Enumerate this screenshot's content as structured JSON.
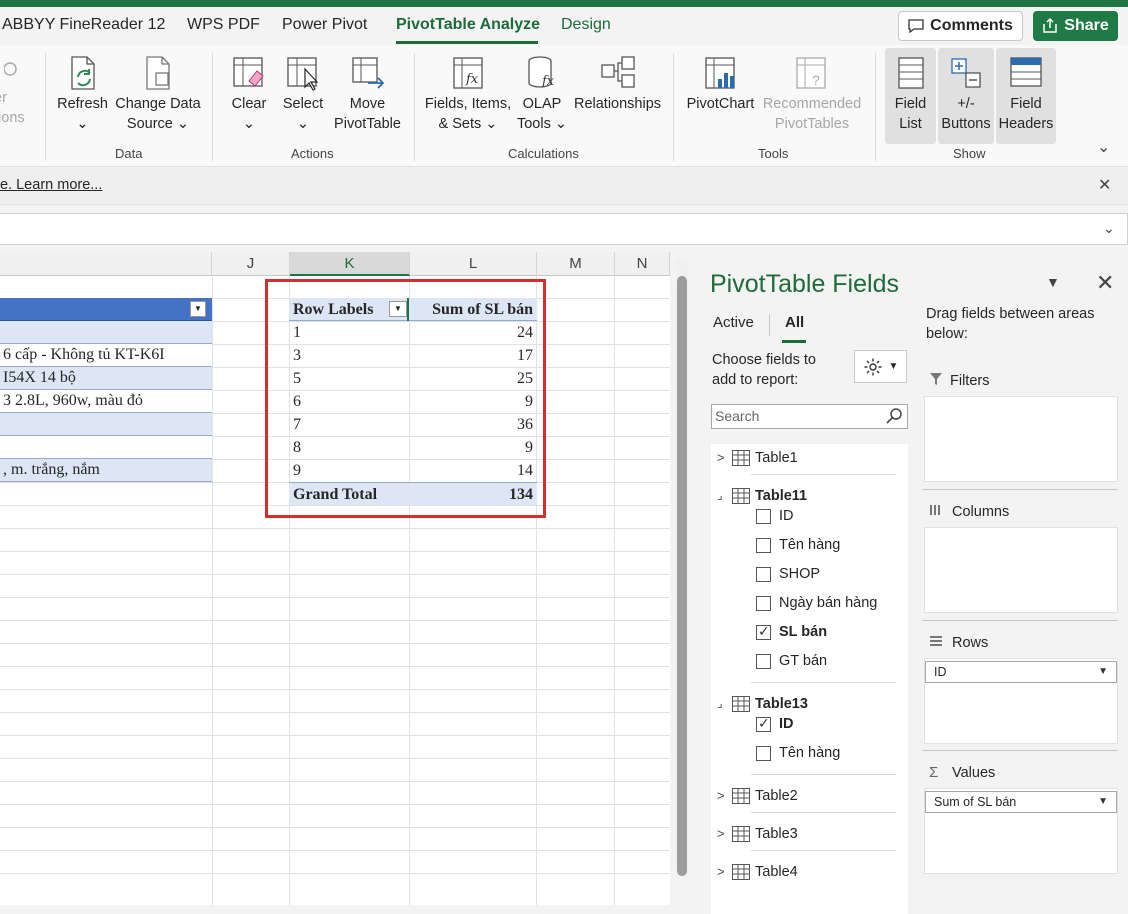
{
  "tabs": {
    "items": [
      "ABBYY FineReader 12",
      "WPS PDF",
      "Power Pivot",
      "PivotTable Analyze",
      "Design"
    ],
    "active": "PivotTable Analyze",
    "comments_label": "Comments",
    "share_label": "Share"
  },
  "ribbon": {
    "partial_left_top": "er",
    "partial_left_bottom": "tions",
    "refresh": "Refresh",
    "change_data_source_1": "Change Data",
    "change_data_source_2": "Source",
    "group_data": "Data",
    "clear": "Clear",
    "select": "Select",
    "move_1": "Move",
    "move_2": "PivotTable",
    "group_actions": "Actions",
    "fields_1": "Fields, Items,",
    "fields_2": "& Sets",
    "olap_1": "OLAP",
    "olap_2": "Tools",
    "relationships": "Relationships",
    "group_calculations": "Calculations",
    "pivotchart": "PivotChart",
    "recommended_1": "Recommended",
    "recommended_2": "PivotTables",
    "group_tools": "Tools",
    "field_list_1": "Field",
    "field_list_2": "List",
    "buttons_1": "+/-",
    "buttons_2": "Buttons",
    "headers_1": "Field",
    "headers_2": "Headers",
    "group_show": "Show"
  },
  "infobar": {
    "text": "e. Learn more..."
  },
  "sheet": {
    "columns": [
      "J",
      "K",
      "L",
      "M",
      "N"
    ],
    "left_rows": [
      "",
      "",
      " 6 cấp - Không tủ KT-K6I",
      "I54X 14 bộ",
      "3 2.8L, 960w, màu đỏ",
      "",
      "",
      ", m. trắng, nắm"
    ]
  },
  "pivot": {
    "header_label": "Row Labels",
    "header_value": "Sum of SL bán",
    "rows": [
      {
        "label": "1",
        "value": "24"
      },
      {
        "label": "3",
        "value": "17"
      },
      {
        "label": "5",
        "value": "25"
      },
      {
        "label": "6",
        "value": "9"
      },
      {
        "label": "7",
        "value": "36"
      },
      {
        "label": "8",
        "value": "9"
      },
      {
        "label": "9",
        "value": "14"
      }
    ],
    "total_label": "Grand Total",
    "total_value": "134"
  },
  "panel": {
    "title": "PivotTable Fields",
    "tab_active": "Active",
    "tab_all": "All",
    "choose_1": "Choose fields to",
    "choose_2": "add to report:",
    "search_placeholder": "Search",
    "tables": {
      "table1": "Table1",
      "table11": "Table11",
      "table11_fields": [
        {
          "name": "ID",
          "checked": false
        },
        {
          "name": "Tên hàng",
          "checked": false
        },
        {
          "name": "SHOP",
          "checked": false
        },
        {
          "name": "Ngày bán hàng",
          "checked": false
        },
        {
          "name": "SL bán",
          "checked": true
        },
        {
          "name": "GT bán",
          "checked": false
        }
      ],
      "table13": "Table13",
      "table13_fields": [
        {
          "name": "ID",
          "checked": true
        },
        {
          "name": "Tên hàng",
          "checked": false
        }
      ],
      "table2": "Table2",
      "table3": "Table3",
      "table4": "Table4"
    },
    "drag_1": "Drag fields between areas",
    "drag_2": "below:",
    "filters": "Filters",
    "columns": "Columns",
    "rows": "Rows",
    "rows_field": "ID",
    "values": "Values",
    "values_field": "Sum of SL bán"
  },
  "colors": {
    "accent": "#1e6b3a",
    "highlight": "#d32f2f",
    "pivot_fill": "#dce6f4"
  }
}
